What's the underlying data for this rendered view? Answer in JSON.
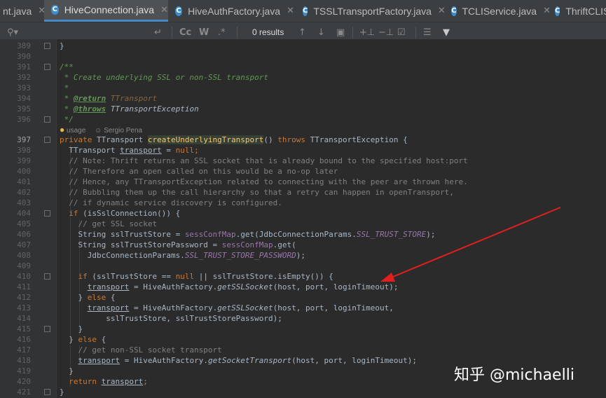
{
  "tabs": [
    {
      "label": "nt.java",
      "active": false,
      "icon": ""
    },
    {
      "label": "HiveConnection.java",
      "active": true,
      "icon": "class-icon"
    },
    {
      "label": "HiveAuthFactory.java",
      "active": false,
      "icon": "class-icon"
    },
    {
      "label": "TSSLTransportFactory.java",
      "active": false,
      "icon": "class-icon"
    },
    {
      "label": "TCLIService.java",
      "active": false,
      "icon": "class-icon"
    },
    {
      "label": "ThriftCLIS",
      "active": false,
      "icon": "class-icon"
    }
  ],
  "search": {
    "results": "0 results",
    "match_case": "Cc",
    "words": "W",
    "regex": ".*"
  },
  "gutter": {
    "lines": [
      "389",
      "390",
      "391",
      "392",
      "393",
      "394",
      "395",
      "396",
      "",
      "397",
      "398",
      "399",
      "400",
      "401",
      "402",
      "403",
      "404",
      "405",
      "406",
      "407",
      "408",
      "409",
      "410",
      "411",
      "412",
      "413",
      "414",
      "415",
      "416",
      "417",
      "418",
      "419",
      "420",
      "421"
    ]
  },
  "usage_hint": {
    "usages": "usage",
    "author": "Sergio Pena"
  },
  "code": {
    "l389": "}",
    "l391": "/**",
    "l392": " * Create underlying SSL or non-SSL transport",
    "l393": " *",
    "l394_pre": " * ",
    "l394_tag": "@return",
    "l394_post": " TTransport",
    "l395_pre": " * ",
    "l395_tag": "@throws",
    "l395_post": " TTransportException",
    "l396": " */",
    "l397_k1": "private",
    "l397_t": " TTransport ",
    "l397_m": "createUnderlyingTransport",
    "l397_p": "() ",
    "l397_k2": "throws",
    "l397_e": " TTransportException {",
    "l398_a": "  TTransport ",
    "l398_b": "transport",
    "l398_c": " = ",
    "l398_d": "null",
    "l398_e": ";",
    "l399": "  // Note: Thrift returns an SSL socket that is already bound to the specified host:port",
    "l400": "  // Therefore an open called on this would be a no-op later",
    "l401": "  // Hence, any TTransportException related to connecting with the peer are thrown here.",
    "l402": "  // Bubbling them up the call hierarchy so that a retry can happen in openTransport,",
    "l403": "  // if dynamic service discovery is configured.",
    "l404_k": "  if",
    "l404_r": " (isSslConnection()) {",
    "l405": "    // get SSL socket",
    "l406_a": "    String sslTrustStore = ",
    "l406_b": "sessConfMap",
    "l406_c": ".get(JdbcConnectionParams.",
    "l406_d": "SSL_TRUST_STORE",
    "l406_e": ");",
    "l407_a": "    String sslTrustStorePassword = ",
    "l407_b": "sessConfMap",
    "l407_c": ".get(",
    "l408_a": "      JdbcConnectionParams.",
    "l408_b": "SSL_TRUST_STORE_PASSWORD",
    "l408_c": ");",
    "l410_k": "    if",
    "l410_a": " (sslTrustStore == ",
    "l410_n": "null",
    "l410_b": " || sslTrustStore.isEmpty()) {",
    "l411_a": "      ",
    "l411_b": "transport",
    "l411_c": " = HiveAuthFactory.",
    "l411_d": "getSSLSocket",
    "l411_e": "(host, port, loginTimeout);",
    "l412_a": "    } ",
    "l412_k": "else",
    "l412_b": " {",
    "l413_a": "      ",
    "l413_b": "transport",
    "l413_c": " = HiveAuthFactory.",
    "l413_d": "getSSLSocket",
    "l413_e": "(host, port, loginTimeout,",
    "l414": "          sslTrustStore, sslTrustStorePassword);",
    "l415": "    }",
    "l416_a": "  } ",
    "l416_k": "else",
    "l416_b": " {",
    "l417": "    // get non-SSL socket transport",
    "l418_a": "    ",
    "l418_b": "transport",
    "l418_c": " = HiveAuthFactory.",
    "l418_d": "getSocketTransport",
    "l418_e": "(host, port, loginTimeout);",
    "l419": "  }",
    "l420_k": "  return",
    "l420_a": " ",
    "l420_b": "transport",
    "l420_c": ";",
    "l421": "}"
  },
  "annotation": {
    "arrow_color": "#e02020"
  },
  "watermark": "知乎 @michaelli"
}
